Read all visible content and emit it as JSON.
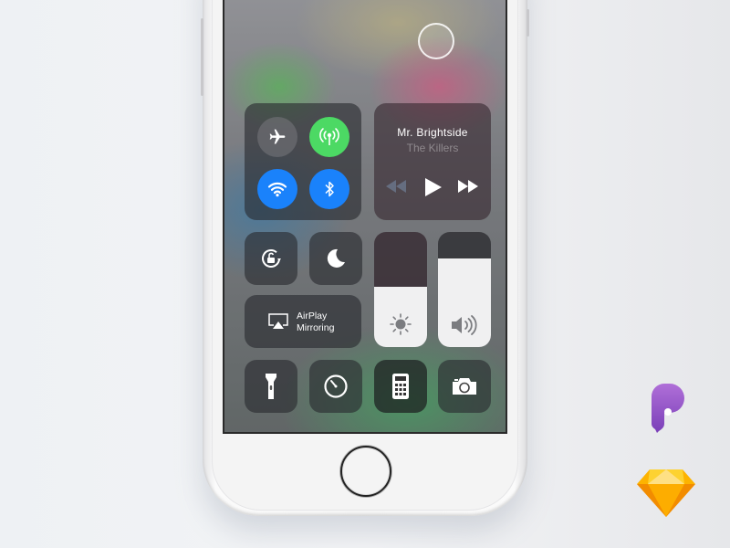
{
  "control_center": {
    "connectivity": {
      "airplane_mode": {
        "name": "Airplane Mode",
        "state": "off",
        "icon": "airplane-icon"
      },
      "cellular_data": {
        "name": "Cellular Data",
        "state": "on",
        "icon": "antenna-icon",
        "color": "#4cd964"
      },
      "wifi": {
        "name": "Wi-Fi",
        "state": "on",
        "icon": "wifi-icon",
        "color": "#1a82fb"
      },
      "bluetooth": {
        "name": "Bluetooth",
        "state": "on",
        "icon": "bluetooth-icon",
        "color": "#1a82fb"
      }
    },
    "music": {
      "title": "Mr. Brightside",
      "artist": "The Killers",
      "controls": [
        "previous",
        "play",
        "next"
      ]
    },
    "toggles": {
      "rotation_lock": {
        "name": "Orientation Lock",
        "icon": "rotation-lock-icon"
      },
      "do_not_disturb": {
        "name": "Do Not Disturb",
        "icon": "moon-icon"
      }
    },
    "airplay": {
      "line1": "AirPlay",
      "line2": "Mirroring"
    },
    "brightness": {
      "level_percent": 52,
      "icon": "sun-icon"
    },
    "volume": {
      "level_percent": 77,
      "icon": "speaker-icon"
    },
    "shortcuts": [
      {
        "name": "Flashlight",
        "icon": "flashlight-icon"
      },
      {
        "name": "Timer",
        "icon": "timer-icon"
      },
      {
        "name": "Calculator",
        "icon": "calculator-icon"
      },
      {
        "name": "Camera",
        "icon": "camera-icon"
      }
    ]
  },
  "branding": {
    "app_logo_color": "#9b59d0",
    "sketch_logo_color": "#f7b733"
  }
}
